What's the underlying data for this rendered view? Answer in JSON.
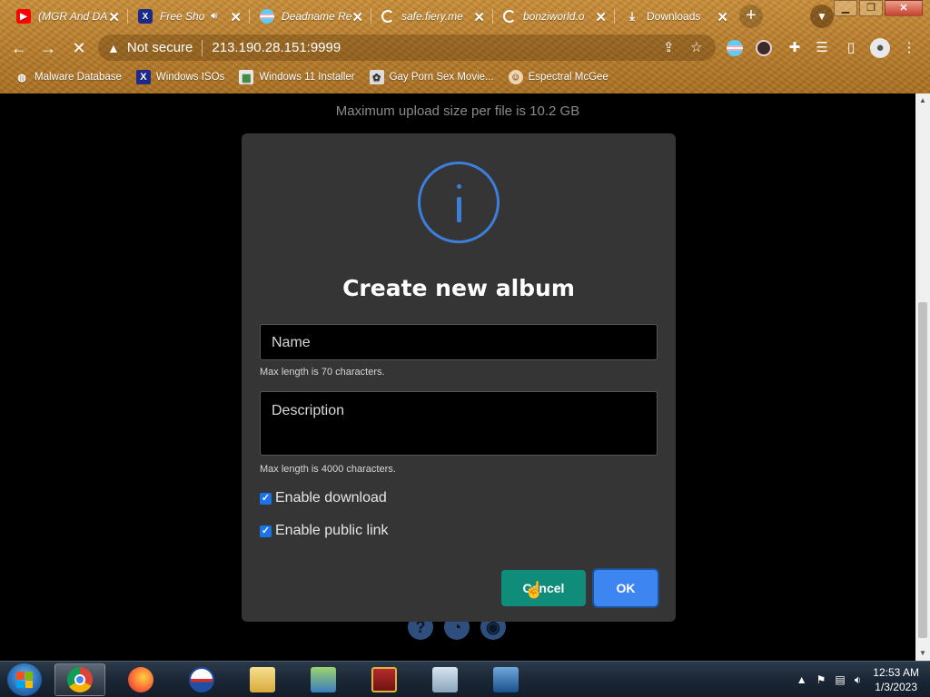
{
  "browser": {
    "tabs": [
      {
        "label": "(MGR And DA",
        "icon": "youtube-icon"
      },
      {
        "label": "Free Sho",
        "icon": "x-icon"
      },
      {
        "label": "Deadname Re",
        "icon": "flag-circle-icon"
      },
      {
        "label": "safe.fiery.me",
        "icon": "loading-icon"
      },
      {
        "label": "bonziworld.o",
        "icon": "loading-icon"
      },
      {
        "label": "Downloads",
        "icon": "download-icon"
      }
    ],
    "address": {
      "security_label": "Not secure",
      "url": "213.190.28.151:9999"
    },
    "bookmarks": [
      {
        "label": "Malware Database",
        "icon": "globe-icon"
      },
      {
        "label": "Windows ISOs",
        "icon": "x-icon"
      },
      {
        "label": "Windows 11 Installer",
        "icon": "image-icon"
      },
      {
        "label": "Gay Porn Sex Movie...",
        "icon": "site-icon"
      },
      {
        "label": "Espectral McGee",
        "icon": "avatar-icon"
      }
    ]
  },
  "page": {
    "upload_note": "Maximum upload size per file is 10.2 GB"
  },
  "modal": {
    "title": "Create new album",
    "name_placeholder": "Name",
    "name_hint": "Max length is 70 characters.",
    "description_placeholder": "Description",
    "description_hint": "Max length is 4000 characters.",
    "checkboxes": [
      {
        "label": "Enable download",
        "checked": true
      },
      {
        "label": "Enable public link",
        "checked": true
      }
    ],
    "cancel_label": "Cancel",
    "ok_label": "OK",
    "accent": "#3d7edb"
  },
  "taskbar": {
    "apps": [
      "chrome",
      "firefox",
      "obama",
      "file-explorer",
      "network",
      "winrar",
      "task-manager",
      "remote-desktop"
    ],
    "time": "12:53 AM",
    "date": "1/3/2023"
  }
}
